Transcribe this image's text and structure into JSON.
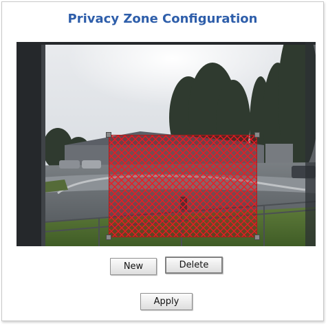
{
  "title": "Privacy Zone Configuration",
  "camera_view": {
    "privacy_zone": {
      "fill_color": "#d01e26",
      "handle_color": "#8a8a8a"
    }
  },
  "buttons": {
    "new_label": "New",
    "delete_label": "Delete",
    "apply_label": "Apply"
  },
  "colors": {
    "title": "#2e5eaa",
    "panel_border": "#c9c9c9"
  }
}
